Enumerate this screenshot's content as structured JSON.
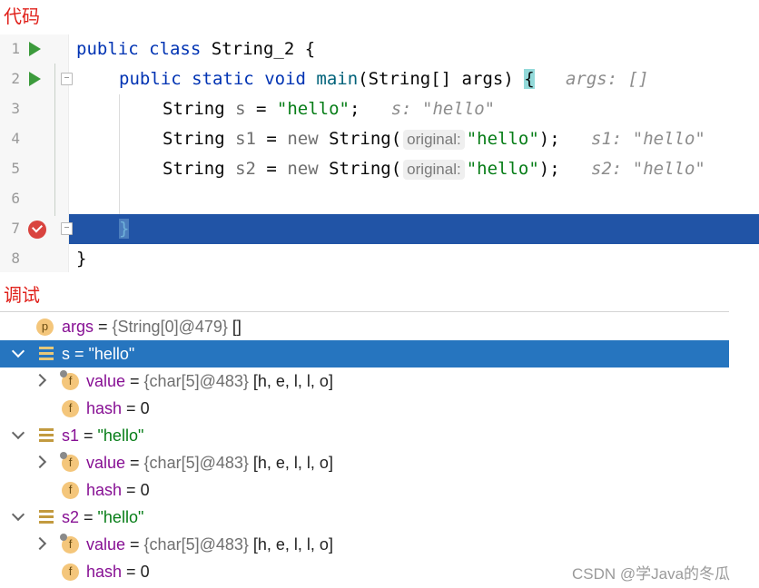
{
  "labels": {
    "code": "代码",
    "debug": "调试"
  },
  "editor": {
    "line_numbers": [
      "1",
      "2",
      "3",
      "4",
      "5",
      "6",
      "7",
      "8"
    ],
    "line1": {
      "kw1": "public",
      "kw2": "class",
      "name": "String_2 {"
    },
    "line2": {
      "kw1": "public",
      "kw2": "static",
      "kw3": "void",
      "fn": "main",
      "params": "(String[] args) ",
      "brace": "{",
      "hint": "args: []"
    },
    "line3": {
      "type": "String",
      "var": "s",
      "eq": " = ",
      "str": "\"hello\"",
      "semi": ";",
      "hint": "s: \"hello\""
    },
    "line4": {
      "type": "String",
      "var": "s1",
      "eq": " = ",
      "kw": "new",
      "ctor": "String(",
      "param_hint": "original:",
      "str": "\"hello\"",
      "end": ");",
      "hint": "s1: \"hello\""
    },
    "line5": {
      "type": "String",
      "var": "s2",
      "eq": " = ",
      "kw": "new",
      "ctor": "String(",
      "param_hint": "original:",
      "str": "\"hello\"",
      "end": ");",
      "hint": "s2: \"hello\""
    },
    "line7": {
      "brace": "}"
    },
    "line8": {
      "brace": "}"
    }
  },
  "variables": {
    "args": {
      "badge": "p",
      "name": "args",
      "eq": " = ",
      "ref": "{String[0]@479}",
      "value": " []"
    },
    "s": {
      "name": "s",
      "eq": " = ",
      "value": "\"hello\"",
      "value_field": {
        "badge": "f",
        "name": "value",
        "eq": " = ",
        "ref": "{char[5]@483}",
        "value": " [h, e, l, l, o]"
      },
      "hash_field": {
        "badge": "f",
        "name": "hash",
        "eq": " = ",
        "value": "0"
      }
    },
    "s1": {
      "name": "s1",
      "eq": " = ",
      "value": "\"hello\"",
      "value_field": {
        "badge": "f",
        "name": "value",
        "eq": " = ",
        "ref": "{char[5]@483}",
        "value": " [h, e, l, l, o]"
      },
      "hash_field": {
        "badge": "f",
        "name": "hash",
        "eq": " = ",
        "value": "0"
      }
    },
    "s2": {
      "name": "s2",
      "eq": " = ",
      "value": "\"hello\"",
      "value_field": {
        "badge": "f",
        "name": "value",
        "eq": " = ",
        "ref": "{char[5]@483}",
        "value": " [h, e, l, l, o]"
      },
      "hash_field": {
        "badge": "f",
        "name": "hash",
        "eq": " = ",
        "value": "0"
      }
    }
  },
  "watermark": "CSDN @学Java的冬瓜",
  "colors": {
    "selection": "#2675bf",
    "exec_line": "#2154a6",
    "label_red": "#e0211b"
  }
}
